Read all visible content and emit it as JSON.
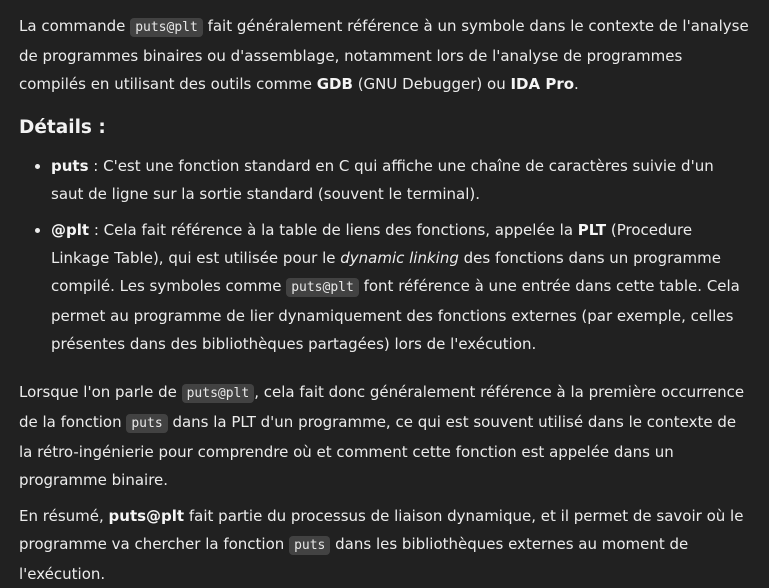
{
  "intro": {
    "t1": "La commande ",
    "code1": "puts@plt",
    "t2": " fait généralement référence à un symbole dans le contexte de l'analyse de programmes binaires ou d'assemblage, notamment lors de l'analyse de programmes compilés en utilisant des outils comme ",
    "b1": "GDB",
    "t3": " (GNU Debugger) ou ",
    "b2": "IDA Pro",
    "t4": "."
  },
  "details_heading": "Détails :",
  "bullets": [
    {
      "term": "puts",
      "t1": " : C'est une fonction standard en C qui affiche une chaîne de caractères suivie d'un saut de ligne sur la sortie standard (souvent le terminal)."
    },
    {
      "term": "@plt",
      "t1": " : Cela fait référence à la table de liens des fonctions, appelée la ",
      "b1": "PLT",
      "t2": " (Procedure Linkage Table), qui est utilisée pour le ",
      "i1": "dynamic linking",
      "t3": " des fonctions dans un programme compilé. Les symboles comme ",
      "code1": "puts@plt",
      "t4": " font référence à une entrée dans cette table. Cela permet au programme de lier dynamiquement des fonctions externes (par exemple, celles présentes dans des bibliothèques partagées) lors de l'exécution."
    }
  ],
  "para2": {
    "t1": "Lorsque l'on parle de ",
    "code1": "puts@plt",
    "t2": ", cela fait donc généralement référence à la première occurrence de la fonction ",
    "code2": "puts",
    "t3": " dans la PLT d'un programme, ce qui est souvent utilisé dans le contexte de la rétro-ingénierie pour comprendre où et comment cette fonction est appelée dans un programme binaire."
  },
  "summary": {
    "t1": "En résumé, ",
    "b1": "puts@plt",
    "t2": " fait partie du processus de liaison dynamique, et il permet de savoir où le programme va chercher la fonction ",
    "code1": "puts",
    "t3": " dans les bibliothèques externes au moment de l'exécution."
  },
  "colors": {
    "background": "#212121",
    "text": "#ececec",
    "code_bg": "#424242"
  }
}
